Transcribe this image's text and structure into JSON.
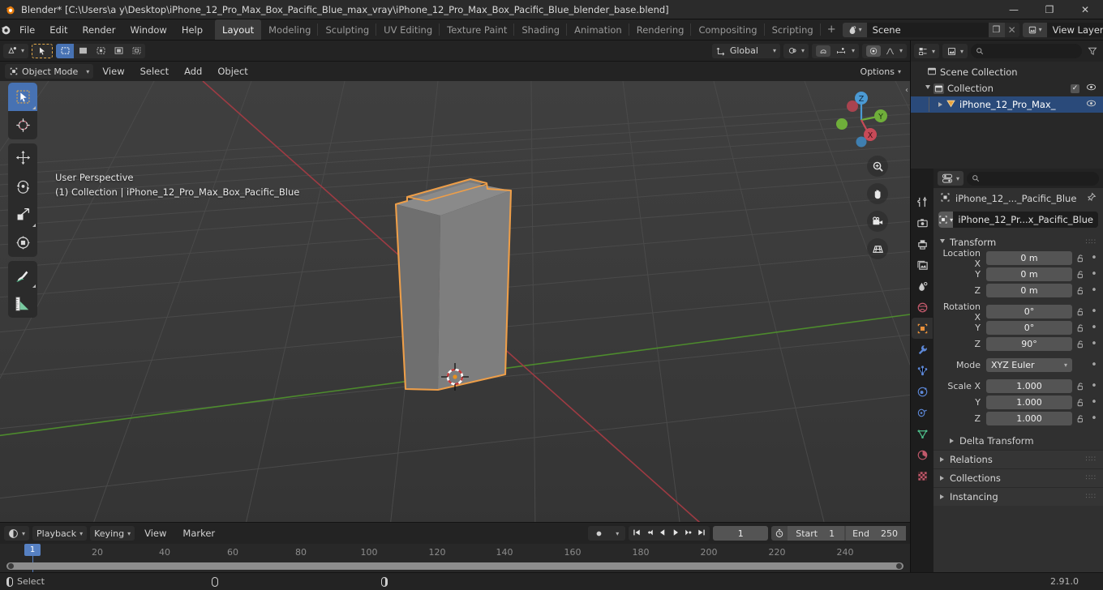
{
  "titlebar": {
    "title": "Blender* [C:\\Users\\a y\\Desktop\\iPhone_12_Pro_Max_Box_Pacific_Blue_max_vray\\iPhone_12_Pro_Max_Box_Pacific_Blue_blender_base.blend]",
    "minimize": "—",
    "maximize": "❐",
    "close": "✕"
  },
  "menus": [
    "File",
    "Edit",
    "Render",
    "Window",
    "Help"
  ],
  "workspace_tabs": [
    {
      "label": "Layout",
      "active": true
    },
    {
      "label": "Modeling",
      "active": false
    },
    {
      "label": "Sculpting",
      "active": false
    },
    {
      "label": "UV Editing",
      "active": false
    },
    {
      "label": "Texture Paint",
      "active": false
    },
    {
      "label": "Shading",
      "active": false
    },
    {
      "label": "Animation",
      "active": false
    },
    {
      "label": "Rendering",
      "active": false
    },
    {
      "label": "Compositing",
      "active": false
    },
    {
      "label": "Scripting",
      "active": false
    }
  ],
  "workspace_add": "+",
  "scene": {
    "name": "Scene",
    "copy": "❐",
    "close": "✕"
  },
  "viewlayer": {
    "name": "View Layer",
    "copy": "❐",
    "close": "✕"
  },
  "viewport_header": {
    "editor_type": "editor-type-3dview",
    "select_tool": "tweak",
    "mode": "Object Mode",
    "menus": [
      "View",
      "Select",
      "Add",
      "Object"
    ],
    "transform_orientation": "Global",
    "pivot": "pivot-point",
    "snap_magnet": "magnet",
    "snap_target": "snap-increment",
    "proportional": "proportional-editing",
    "options": "Options"
  },
  "viewport_info": {
    "perspective": "User Perspective",
    "context": "(1) Collection | iPhone_12_Pro_Max_Box_Pacific_Blue"
  },
  "gizmo_axes": {
    "x": "X",
    "y": "Y",
    "z": "Z"
  },
  "timeline": {
    "editor": "timeline-editor",
    "menus": [
      "Playback",
      "Keying",
      "View",
      "Marker"
    ],
    "current_frame": "1",
    "start_label": "Start",
    "start_value": "1",
    "end_label": "End",
    "end_value": "250",
    "ticks": [
      "20",
      "40",
      "60",
      "80",
      "100",
      "120",
      "140",
      "160",
      "180",
      "200",
      "220",
      "240"
    ],
    "playhead_label": "1"
  },
  "outliner": {
    "display_mode": "View Layer",
    "filter": "filter-icon",
    "search_placeholder": "",
    "rows": [
      {
        "label": "Scene Collection",
        "indent": 0,
        "icon": "collection-icon",
        "selected": false,
        "expand": "none",
        "checkbox": false,
        "eye": false
      },
      {
        "label": "Collection",
        "indent": 1,
        "icon": "collection-icon",
        "selected": false,
        "expand": "down",
        "checkbox": true,
        "eye": true
      },
      {
        "label": "iPhone_12_Pro_Max_",
        "indent": 2,
        "icon": "mesh-object-icon",
        "selected": true,
        "expand": "right",
        "checkbox": false,
        "eye": true
      }
    ]
  },
  "properties": {
    "tabs": [
      {
        "name": "tool-tab",
        "glyph": "🔧",
        "selected": false
      },
      {
        "name": "render-tab",
        "glyph": "📷",
        "selected": false
      },
      {
        "name": "output-tab",
        "glyph": "🖨",
        "selected": false
      },
      {
        "name": "view-layer-tab",
        "glyph": "🖼",
        "selected": false
      },
      {
        "name": "scene-tab",
        "glyph": "💧",
        "selected": false
      },
      {
        "name": "world-tab",
        "glyph": "🌍",
        "selected": false
      },
      {
        "name": "object-tab",
        "glyph": "▣",
        "selected": true
      },
      {
        "name": "modifier-tab",
        "glyph": "🔧",
        "selected": false
      },
      {
        "name": "particles-tab",
        "glyph": "⁂",
        "selected": false
      },
      {
        "name": "physics-tab",
        "glyph": "◌",
        "selected": false
      },
      {
        "name": "constraints-tab",
        "glyph": "⛓",
        "selected": false
      },
      {
        "name": "data-tab",
        "glyph": "▽",
        "selected": false
      },
      {
        "name": "material-tab",
        "glyph": "◕",
        "selected": false
      },
      {
        "name": "texture-tab",
        "glyph": "▦",
        "selected": false
      }
    ],
    "breadcrumb": "iPhone_12_..._Pacific_Blue",
    "pin": "pin-icon",
    "object_id": "iPhone_12_Pr...x_Pacific_Blue",
    "transform": {
      "title": "Transform",
      "rows": [
        {
          "label": "Location X",
          "value": "0 m"
        },
        {
          "label": "Y",
          "value": "0 m"
        },
        {
          "label": "Z",
          "value": "0 m"
        },
        {
          "label": "Rotation X",
          "value": "0°"
        },
        {
          "label": "Y",
          "value": "0°"
        },
        {
          "label": "Z",
          "value": "90°"
        }
      ],
      "mode_label": "Mode",
      "mode_value": "XYZ Euler",
      "scale_rows": [
        {
          "label": "Scale X",
          "value": "1.000"
        },
        {
          "label": "Y",
          "value": "1.000"
        },
        {
          "label": "Z",
          "value": "1.000"
        }
      ],
      "delta": "Delta Transform"
    },
    "closed_panels": [
      "Relations",
      "Collections",
      "Instancing"
    ]
  },
  "statusbar": {
    "select_label": "Select",
    "version": "2.91.0"
  },
  "colors": {
    "accent_blue": "#4772b3",
    "select_orange": "#ed9e49",
    "axis_x_red": "#a33b43",
    "axis_y_green": "#4e8f2c",
    "viewport_bg": "#3c3c3c",
    "panel_bg": "#303030"
  }
}
